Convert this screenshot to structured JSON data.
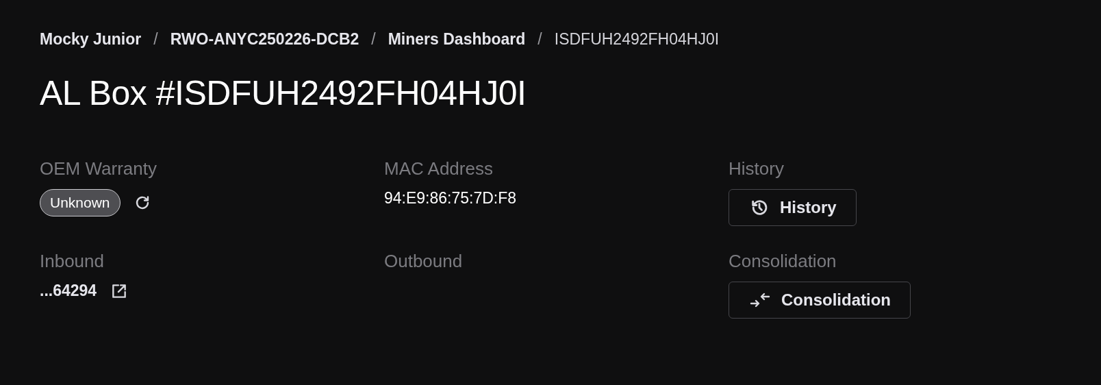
{
  "breadcrumb": [
    {
      "label": "Mocky Junior",
      "current": false
    },
    {
      "label": "RWO-ANYC250226-DCB2",
      "current": false
    },
    {
      "label": "Miners Dashboard",
      "current": false
    },
    {
      "label": "ISDFUH2492FH04HJ0I",
      "current": true
    }
  ],
  "separator": "/",
  "title": "AL Box #ISDFUH2492FH04HJ0I",
  "fields": [
    {
      "label": "OEM Warranty",
      "kind": "badge",
      "value": "Unknown"
    },
    {
      "label": "MAC Address",
      "kind": "text",
      "value": "94:E9:86:75:7D:F8"
    },
    {
      "label": "History",
      "kind": "history-button",
      "value": "History"
    },
    {
      "label": "Inbound",
      "kind": "link",
      "value": "...64294"
    },
    {
      "label": "Outbound",
      "kind": "empty"
    },
    {
      "label": "Consolidation",
      "kind": "consolidation-button",
      "value": "Consolidation"
    }
  ]
}
